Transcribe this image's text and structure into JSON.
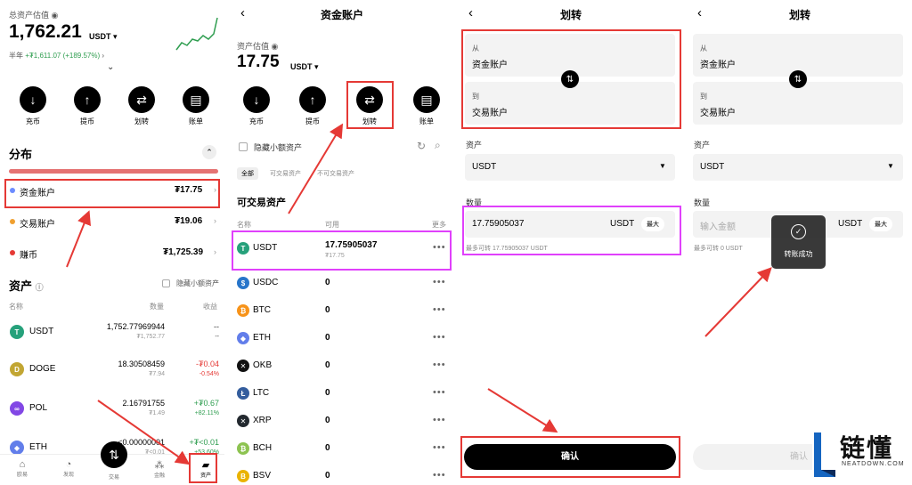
{
  "p1": {
    "asset_label": "总资产估值",
    "total": "1,762.21",
    "unit": "USDT ▾",
    "period": "半年",
    "change": "+₮1,611.07 (+189.57%)",
    "chevron": "⌄",
    "actions": [
      {
        "label": "充币",
        "icon": "↓"
      },
      {
        "label": "提币",
        "icon": "↑"
      },
      {
        "label": "划转",
        "icon": "⇄"
      },
      {
        "label": "账单",
        "icon": "▤"
      }
    ],
    "dist_title": "分布",
    "accounts": [
      {
        "name": "资金账户",
        "value": "₮17.75",
        "color": "#6c8cff"
      },
      {
        "name": "交易账户",
        "value": "₮19.06",
        "color": "#f0a030"
      },
      {
        "name": "赚币",
        "value": "₮1,725.39",
        "color": "#e53935"
      }
    ],
    "assets_title": "资产",
    "hide_small": "隐藏小额资产",
    "cols": [
      "名称",
      "数量",
      "收益"
    ],
    "coins": [
      {
        "name": "USDT",
        "amount": "1,752.77969944",
        "sub": "₮1,752.77",
        "pnl": "--",
        "pnl2": "--",
        "color": "#26a17b",
        "glyph": "T",
        "pnlcolor": "#333"
      },
      {
        "name": "DOGE",
        "amount": "18.30508459",
        "sub": "₮7.94",
        "pnl": "-₮0.04",
        "pnl2": "-0.54%",
        "color": "#c2a633",
        "glyph": "D",
        "pnlcolor": "#e53935"
      },
      {
        "name": "POL",
        "amount": "2.16791755",
        "sub": "₮1.49",
        "pnl": "+₮0.67",
        "pnl2": "+82.11%",
        "color": "#8247e5",
        "glyph": "∞",
        "pnlcolor": "#2e9d4f"
      },
      {
        "name": "ETH",
        "amount": "≤0.00000001",
        "sub": "₮<0.01",
        "pnl": "+₮<0.01",
        "pnl2": "+53.60%",
        "color": "#627eea",
        "glyph": "◆",
        "pnlcolor": "#2e9d4f"
      }
    ],
    "nav": [
      {
        "label": "欧易",
        "icon": "⌂"
      },
      {
        "label": "发现",
        "icon": "◔"
      },
      {
        "label": "交易",
        "icon": "⇅"
      },
      {
        "label": "金融",
        "icon": "⁂"
      },
      {
        "label": "资产",
        "icon": "▰"
      }
    ]
  },
  "p2": {
    "back": "‹",
    "title": "资金账户",
    "asset_label": "资产估值",
    "total": "17.75",
    "unit": "USDT ▾",
    "actions": [
      {
        "label": "充币",
        "icon": "↓"
      },
      {
        "label": "提币",
        "icon": "↑"
      },
      {
        "label": "划转",
        "icon": "⇄"
      },
      {
        "label": "账单",
        "icon": "▤"
      }
    ],
    "hide_small": "隐藏小额资产",
    "filters": [
      "全部",
      "可交易资产",
      "不可交易资产"
    ],
    "section": "可交易资产",
    "cols": [
      "名称",
      "可用",
      "更多"
    ],
    "coins": [
      {
        "name": "USDT",
        "amount": "17.75905037",
        "sub": "₮17.75",
        "color": "#26a17b",
        "glyph": "T"
      },
      {
        "name": "USDC",
        "amount": "0",
        "sub": "",
        "color": "#2775ca",
        "glyph": "$"
      },
      {
        "name": "BTC",
        "amount": "0",
        "sub": "",
        "color": "#f7931a",
        "glyph": "₿"
      },
      {
        "name": "ETH",
        "amount": "0",
        "sub": "",
        "color": "#627eea",
        "glyph": "◆"
      },
      {
        "name": "OKB",
        "amount": "0",
        "sub": "",
        "color": "#111",
        "glyph": "✕"
      },
      {
        "name": "LTC",
        "amount": "0",
        "sub": "",
        "color": "#345d9d",
        "glyph": "Ł"
      },
      {
        "name": "XRP",
        "amount": "0",
        "sub": "",
        "color": "#23292f",
        "glyph": "✕"
      },
      {
        "name": "BCH",
        "amount": "0",
        "sub": "",
        "color": "#8dc351",
        "glyph": "₿"
      },
      {
        "name": "BSV",
        "amount": "0",
        "sub": "",
        "color": "#eab300",
        "glyph": "B"
      }
    ],
    "dots": "•••"
  },
  "p3": {
    "back": "‹",
    "title": "划转",
    "from_label": "从",
    "from": "资金账户",
    "to_label": "到",
    "to": "交易账户",
    "swap": "⇅",
    "asset_label": "资产",
    "asset": "USDT",
    "qty_label": "数量",
    "qty": "17.75905037",
    "qty_unit": "USDT",
    "max": "最大",
    "avail": "最多可转 17.75905037 USDT",
    "confirm": "确认"
  },
  "p4": {
    "back": "‹",
    "title": "划转",
    "from_label": "从",
    "from": "资金账户",
    "to_label": "到",
    "to": "交易账户",
    "swap": "⇅",
    "asset_label": "资产",
    "asset": "USDT",
    "qty_label": "数量",
    "placeholder": "输入金额",
    "qty_unit": "USDT",
    "max": "最大",
    "avail": "最多可转 0 USDT",
    "toast": "转账成功",
    "confirm": "确认",
    "logo_cn": "链懂",
    "logo_en": "NEATDOWN.COM"
  }
}
